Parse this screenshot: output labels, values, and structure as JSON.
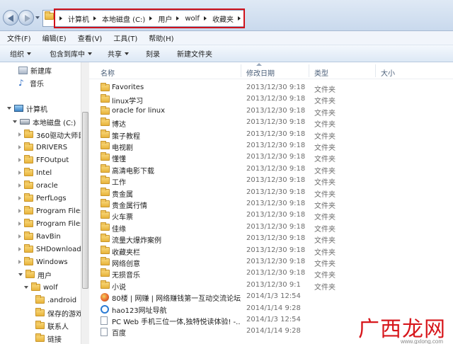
{
  "address": {
    "crumbs": [
      "计算机",
      "本地磁盘 (C:)",
      "用户",
      "wolf",
      "收藏夹"
    ],
    "highlight_color": "#d0121b"
  },
  "menu": [
    "文件(F)",
    "编辑(E)",
    "查看(V)",
    "工具(T)",
    "帮助(H)"
  ],
  "toolbar": {
    "organize": "组织",
    "include": "包含到库中",
    "share": "共享",
    "burn": "刻录",
    "new_folder": "新建文件夹"
  },
  "nav": {
    "items": [
      {
        "label": "新建库",
        "icon": "library-icon"
      },
      {
        "label": "音乐",
        "icon": "music-icon"
      },
      {
        "label": "计算机",
        "icon": "computer-icon"
      },
      {
        "label": "本地磁盘 (C:)",
        "icon": "drive-icon"
      },
      {
        "label": "360驱动大师目",
        "icon": "folder-icon"
      },
      {
        "label": "DRIVERS",
        "icon": "folder-icon"
      },
      {
        "label": "FFOutput",
        "icon": "folder-icon"
      },
      {
        "label": "Intel",
        "icon": "folder-icon"
      },
      {
        "label": "oracle",
        "icon": "folder-icon"
      },
      {
        "label": "PerfLogs",
        "icon": "folder-icon"
      },
      {
        "label": "Program Files",
        "icon": "folder-icon"
      },
      {
        "label": "Program Files",
        "icon": "folder-icon"
      },
      {
        "label": "RavBin",
        "icon": "folder-icon"
      },
      {
        "label": "SHDownload",
        "icon": "folder-icon"
      },
      {
        "label": "Windows",
        "icon": "folder-icon"
      },
      {
        "label": "用户",
        "icon": "folder-icon"
      },
      {
        "label": "wolf",
        "icon": "folder-icon"
      },
      {
        "label": ".android",
        "icon": "folder-icon"
      },
      {
        "label": "保存的游戏",
        "icon": "folder-icon"
      },
      {
        "label": "联系人",
        "icon": "folder-icon"
      },
      {
        "label": "链接",
        "icon": "folder-icon"
      }
    ]
  },
  "columns": {
    "name": "名称",
    "date": "修改日期",
    "type": "类型",
    "size": "大小"
  },
  "files": [
    {
      "name": "Favorites",
      "date": "2013/12/30 9:18",
      "type": "文件夹",
      "icon": "folder-icon"
    },
    {
      "name": "linux学习",
      "date": "2013/12/30 9:18",
      "type": "文件夹",
      "icon": "folder-icon"
    },
    {
      "name": "oracle for linux",
      "date": "2013/12/30 9:18",
      "type": "文件夹",
      "icon": "folder-icon"
    },
    {
      "name": "博达",
      "date": "2013/12/30 9:18",
      "type": "文件夹",
      "icon": "folder-icon"
    },
    {
      "name": "策子教程",
      "date": "2013/12/30 9:18",
      "type": "文件夹",
      "icon": "folder-icon"
    },
    {
      "name": "电视剧",
      "date": "2013/12/30 9:18",
      "type": "文件夹",
      "icon": "folder-icon"
    },
    {
      "name": "懂懂",
      "date": "2013/12/30 9:18",
      "type": "文件夹",
      "icon": "folder-icon"
    },
    {
      "name": "高清电影下载",
      "date": "2013/12/30 9:18",
      "type": "文件夹",
      "icon": "folder-icon"
    },
    {
      "name": "工作",
      "date": "2013/12/30 9:18",
      "type": "文件夹",
      "icon": "folder-icon"
    },
    {
      "name": "贵金属",
      "date": "2013/12/30 9:18",
      "type": "文件夹",
      "icon": "folder-icon"
    },
    {
      "name": "贵金属行情",
      "date": "2013/12/30 9:18",
      "type": "文件夹",
      "icon": "folder-icon"
    },
    {
      "name": "火车票",
      "date": "2013/12/30 9:18",
      "type": "文件夹",
      "icon": "folder-icon"
    },
    {
      "name": "佳缘",
      "date": "2013/12/30 9:18",
      "type": "文件夹",
      "icon": "folder-icon"
    },
    {
      "name": "流量大爆炸案例",
      "date": "2013/12/30 9:18",
      "type": "文件夹",
      "icon": "folder-icon"
    },
    {
      "name": "收藏夹栏",
      "date": "2013/12/30 9:18",
      "type": "文件夹",
      "icon": "folder-icon"
    },
    {
      "name": "网络创意",
      "date": "2013/12/30 9:18",
      "type": "文件夹",
      "icon": "folder-icon"
    },
    {
      "name": "无损音乐",
      "date": "2013/12/30 9:18",
      "type": "文件夹",
      "icon": "folder-icon"
    },
    {
      "name": "小说",
      "date": "2013/12/30 9:1",
      "type": "文件夹",
      "icon": "folder-icon"
    },
    {
      "name": "80楼 | 网赚 | 网络赚钱第一互动交流论坛...",
      "date": "2014/1/3 12:54",
      "type": "",
      "icon": "web-link-icon"
    },
    {
      "name": "hao123网址导航",
      "date": "2014/1/14 9:28",
      "type": "",
      "icon": "ie-icon"
    },
    {
      "name": "PC Web 手机三位一体,独特悦读体验! -...",
      "date": "2014/1/3 12:54",
      "type": "",
      "icon": "file-icon"
    },
    {
      "name": "百度",
      "date": "2014/1/14 9:28",
      "type": "",
      "icon": "file-icon"
    }
  ],
  "watermark": {
    "text": "广西龙网",
    "sub": "www.gxlong.com"
  }
}
